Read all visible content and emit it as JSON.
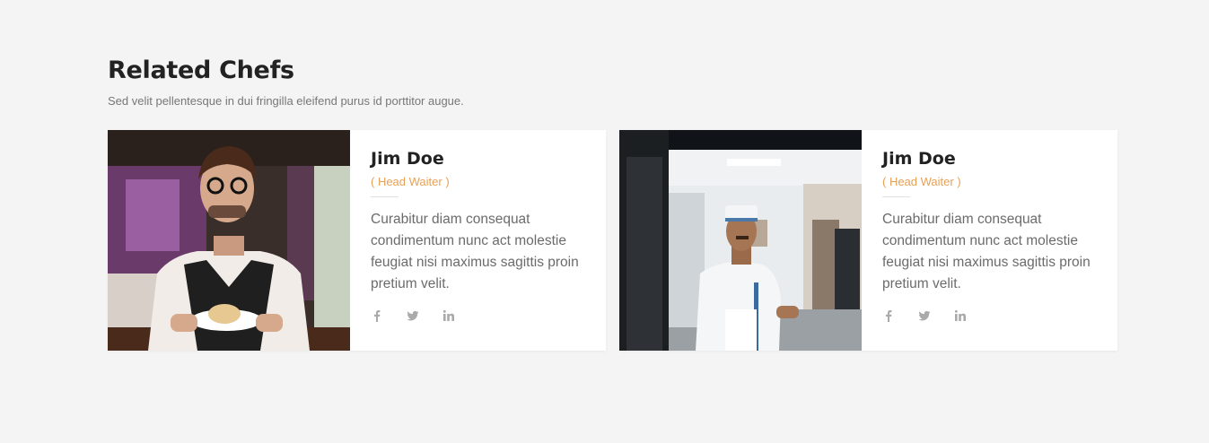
{
  "section": {
    "title": "Related Chefs",
    "subtitle": "Sed velit pellentesque in dui fringilla eleifend purus id porttitor augue."
  },
  "cards": [
    {
      "name": "Jim Doe",
      "role": "( Head Waiter )",
      "description": "Curabitur diam consequat condimentum nunc act molestie feugiat nisi maximus sagittis proin pretium velit.",
      "social": [
        "facebook-icon",
        "twitter-icon",
        "linkedin-icon"
      ]
    },
    {
      "name": "Jim Doe",
      "role": "( Head Waiter )",
      "description": "Curabitur diam consequat condimentum nunc act molestie feugiat nisi maximus sagittis proin pretium velit.",
      "social": [
        "facebook-icon",
        "twitter-icon",
        "linkedin-icon"
      ]
    }
  ],
  "colors": {
    "background": "#f4f4f4",
    "card": "#ffffff",
    "accent": "#e6a157",
    "icon": "#aaaaaa"
  }
}
